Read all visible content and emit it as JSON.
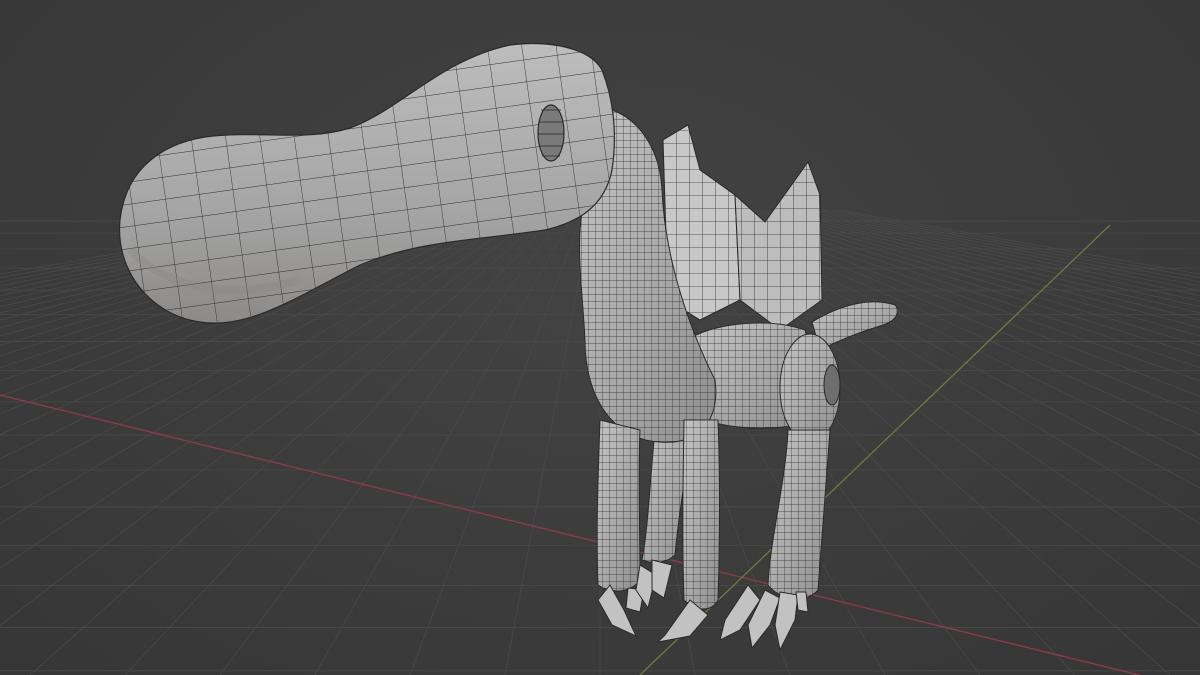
{
  "viewport": {
    "mode": "3D viewport",
    "shading": "solid",
    "overlays": [
      "wireframe",
      "floor-grid"
    ],
    "colors": {
      "background": "#3d3d3d",
      "grid_line": "#4a4a4a",
      "x_axis": "#8a3b48",
      "y_axis": "#6b7d38",
      "mesh_fill": "#a9a9a9",
      "mesh_wire": "#2a2a2a"
    }
  },
  "model": {
    "type": "creature",
    "parts": [
      "head",
      "eye",
      "neck",
      "wings",
      "body",
      "tail",
      "front-legs",
      "back-legs",
      "claws"
    ]
  }
}
